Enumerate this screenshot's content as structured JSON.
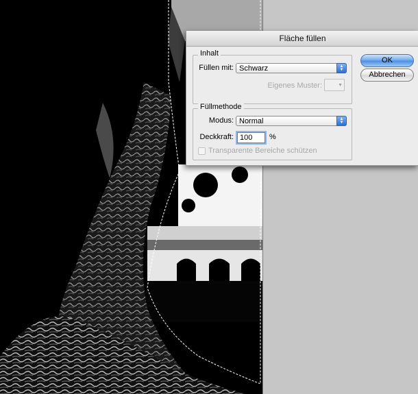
{
  "dialog": {
    "title": "Fläche füllen",
    "content_group": {
      "title": "Inhalt",
      "fill_with_label": "Füllen mit:",
      "fill_with_value": "Schwarz",
      "custom_pattern_label": "Eigenes Muster:"
    },
    "method_group": {
      "title": "Füllmethode",
      "mode_label": "Modus:",
      "mode_value": "Normal",
      "opacity_label": "Deckkraft:",
      "opacity_value": "100",
      "opacity_unit": "%",
      "preserve_transparency_label": "Transparente Bereiche schützen"
    },
    "ok_label": "OK",
    "cancel_label": "Abbrechen"
  },
  "colors": {
    "background": "#c6c6c6",
    "dialog": "#ececec",
    "accent": "#4a8de0"
  },
  "icons": {
    "select_stepper": "up-down-arrows-icon",
    "pattern_dropdown": "chevron-down-icon"
  }
}
